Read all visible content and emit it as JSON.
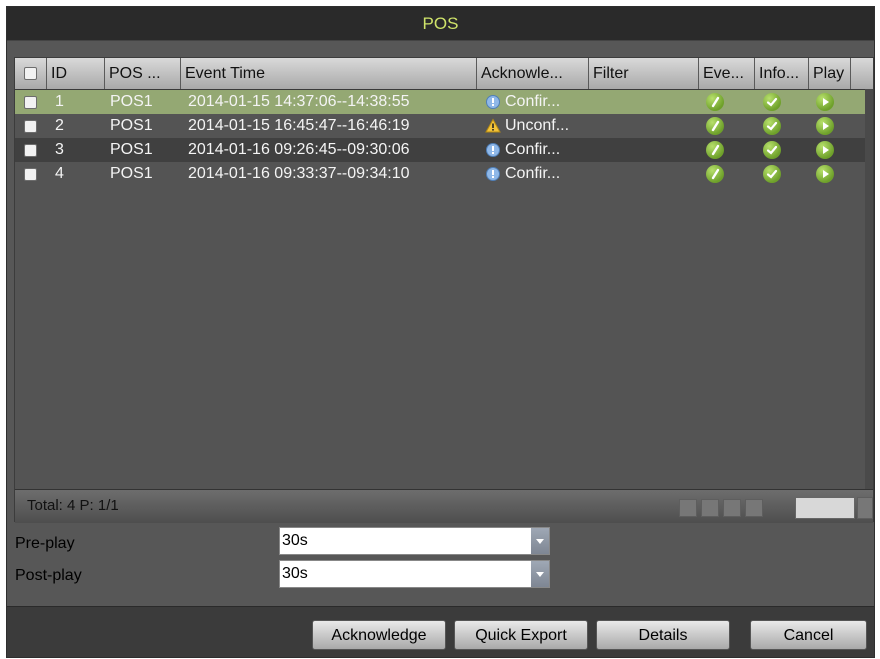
{
  "title": "POS",
  "columns": {
    "id": "ID",
    "pos": "POS ...",
    "event_time": "Event Time",
    "acknowledge": "Acknowle...",
    "filter": "Filter",
    "event": "Eve...",
    "info": "Info...",
    "play": "Play"
  },
  "rows": [
    {
      "id": "1",
      "pos": "POS1",
      "time": "2014-01-15 14:37:06--14:38:55",
      "ack": "Confir...",
      "ack_icon": "info-icon",
      "selected": true
    },
    {
      "id": "2",
      "pos": "POS1",
      "time": "2014-01-15 16:45:47--16:46:19",
      "ack": "Unconf...",
      "ack_icon": "warning-icon",
      "selected": false
    },
    {
      "id": "3",
      "pos": "POS1",
      "time": "2014-01-16 09:26:45--09:30:06",
      "ack": "Confir...",
      "ack_icon": "info-icon",
      "selected": false
    },
    {
      "id": "4",
      "pos": "POS1",
      "time": "2014-01-16 09:33:37--09:34:10",
      "ack": "Confir...",
      "ack_icon": "info-icon",
      "selected": false
    }
  ],
  "footer": {
    "total": "Total: 4  P: 1/1"
  },
  "settings": {
    "preplay_label": "Pre-play",
    "preplay_value": "30s",
    "postplay_label": "Post-play",
    "postplay_value": "30s"
  },
  "buttons": {
    "acknowledge": "Acknowledge",
    "quick_export": "Quick Export",
    "details": "Details",
    "cancel": "Cancel"
  },
  "colors": {
    "title_text": "#cfe36a",
    "selected_row": "#94a873",
    "icon_green": "#7db534"
  }
}
